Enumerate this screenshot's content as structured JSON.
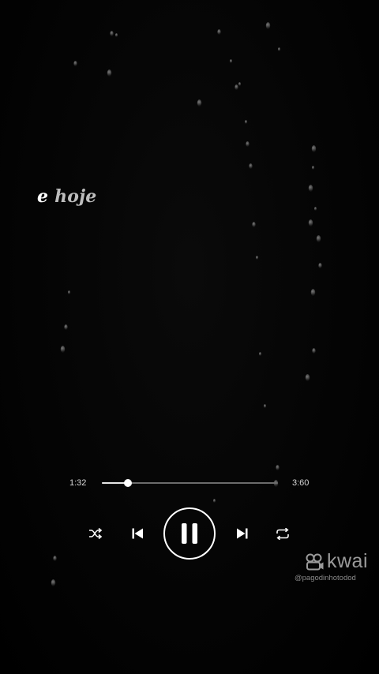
{
  "lyrics": {
    "word_1": "e",
    "word_2": "hoje"
  },
  "player": {
    "current_time": "1:32",
    "total_time": "3:60",
    "progress_fraction": 0.15,
    "state": "playing",
    "controls": {
      "shuffle_icon": "shuffle-icon",
      "previous_icon": "skip-previous-icon",
      "play_pause_icon": "pause-icon",
      "next_icon": "skip-next-icon",
      "repeat_icon": "repeat-icon"
    }
  },
  "watermark": {
    "brand": "kwai",
    "logo_icon": "kwai-logo-icon",
    "handle": "@pagodinhotodod"
  },
  "colors": {
    "background": "#000000",
    "foreground": "#ffffff",
    "muted_text": "#bdbdbd",
    "track_inactive": "#6b6b6b"
  }
}
